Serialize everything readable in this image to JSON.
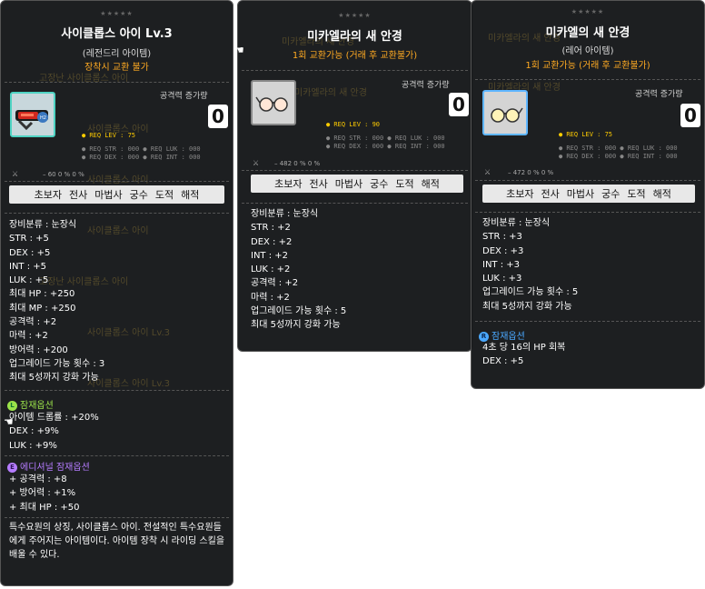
{
  "tooltip1": {
    "stars": "★★★★★",
    "title": "사이클롭스 아이 Lv.3",
    "grade": "(레전드리 아이템)",
    "trade": "장착시 교환 불가",
    "icon": "cyclops-eye-icon",
    "atk_label": "공격력 증가량",
    "atk_value": "0",
    "req_lev": "● REQ LEV : 75",
    "req_row1": "● REQ STR : 000   ● REQ LUK : 000",
    "req_row2": "● REQ DEX : 000   ● REQ INT : 000",
    "small_stats": "– 60    0 %    0 %",
    "jobs": [
      "초보자",
      "전사",
      "마법사",
      "궁수",
      "도적",
      "해적"
    ],
    "stats": [
      "장비분류 : 눈장식",
      "STR : +5",
      "DEX : +5",
      "INT : +5",
      "LUK : +5",
      "최대 HP : +250",
      "최대 MP : +250",
      "공격력 : +2",
      "마력 : +2",
      "방어력 : +200",
      "업그레이드 가능 횟수 : 3",
      "최대 5성까지 강화 가능"
    ],
    "potential_badge": "L",
    "potential_title": "잠재옵션",
    "potential": [
      "아이템 드롭률 : +20%",
      "DEX : +9%",
      "LUK : +9%"
    ],
    "additional_badge": "E",
    "additional_title": "에디셔널 잠재옵션",
    "additional": [
      "+ 공격력 : +8",
      "+ 방어력 : +1%",
      "+ 최대 HP : +50"
    ],
    "description": "특수요원의 상징, 사이클롭스 아이. 전설적인 특수요원들에게 주어지는 아이템이다. 아이템 장착 시 라이딩 스킬을 배울 수 있다."
  },
  "tooltip2": {
    "stars": "★★★★★",
    "title": "미카엘라의 새 안경",
    "trade": "1회 교환가능 (거래 후 교환불가)",
    "icon": "glasses-icon",
    "atk_label": "공격력 증가량",
    "atk_value": "0",
    "req_lev": "● REQ LEV : 90",
    "req_row1": "● REQ STR : 000   ● REQ LUK : 000",
    "req_row2": "● REQ DEX : 000   ● REQ INT : 000",
    "small_stats": "– 482    0 %    0 %",
    "jobs": [
      "초보자",
      "전사",
      "마법사",
      "궁수",
      "도적",
      "해적"
    ],
    "stats": [
      "장비분류 : 눈장식",
      "STR : +2",
      "DEX : +2",
      "INT : +2",
      "LUK : +2",
      "공격력 : +2",
      "마력 : +2",
      "업그레이드 가능 횟수 : 5",
      "최대 5성까지 강화 가능"
    ]
  },
  "tooltip3": {
    "stars": "★★★★★",
    "title": "미카엘의 새 안경",
    "grade": "(레어 아이템)",
    "trade": "1회 교환가능 (거래 후 교환불가)",
    "icon": "glasses-icon",
    "atk_label": "공격력 증가량",
    "atk_value": "0",
    "req_lev": "● REQ LEV : 75",
    "req_row1": "● REQ STR : 000   ● REQ LUK : 000",
    "req_row2": "● REQ DEX : 000   ● REQ INT : 000",
    "small_stats": "– 472    0 %    0 %",
    "jobs": [
      "초보자",
      "전사",
      "마법사",
      "궁수",
      "도적",
      "해적"
    ],
    "stats": [
      "장비분류 : 눈장식",
      "STR : +3",
      "DEX : +3",
      "INT : +3",
      "LUK : +3",
      "업그레이드 가능 횟수 : 5",
      "최대 5성까지 강화 가능"
    ],
    "potential_badge": "R",
    "potential_title": "잠재옵션",
    "potential": [
      "4초 당 16의 HP 회복",
      "DEX : +5"
    ]
  },
  "colors": {
    "trade": "#ffaa22",
    "legendary": "#9be34a",
    "epic": "#b57cff",
    "rare": "#4aa8ff",
    "job_bg": "#e8e8e8"
  }
}
